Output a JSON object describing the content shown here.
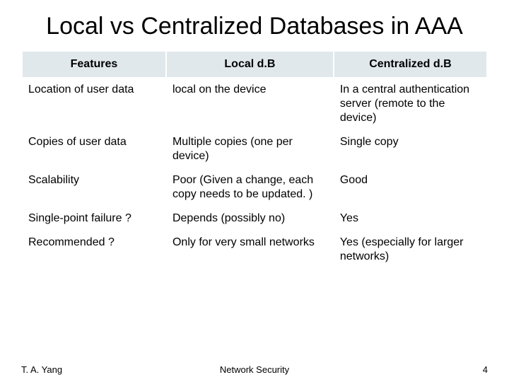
{
  "title": "Local vs Centralized Databases in AAA",
  "table": {
    "headers": [
      "Features",
      "Local d.B",
      "Centralized d.B"
    ],
    "rows": [
      {
        "feature": "Location of user data",
        "local": "local on the device",
        "central": "In a central authentication server (remote to the device)"
      },
      {
        "feature": "Copies of user data",
        "local": "Multiple copies (one per device)",
        "central": "Single copy"
      },
      {
        "feature": "Scalability",
        "local": "Poor (Given a change, each copy needs to be updated. )",
        "central": "Good"
      },
      {
        "feature": "Single-point failure ?",
        "local": "Depends (possibly no)",
        "central": "Yes"
      },
      {
        "feature": "Recommended ?",
        "local": "Only for very small networks",
        "central": "Yes (especially for larger networks)"
      }
    ]
  },
  "footer": {
    "left": "T. A. Yang",
    "center": "Network Security",
    "right": "4"
  }
}
